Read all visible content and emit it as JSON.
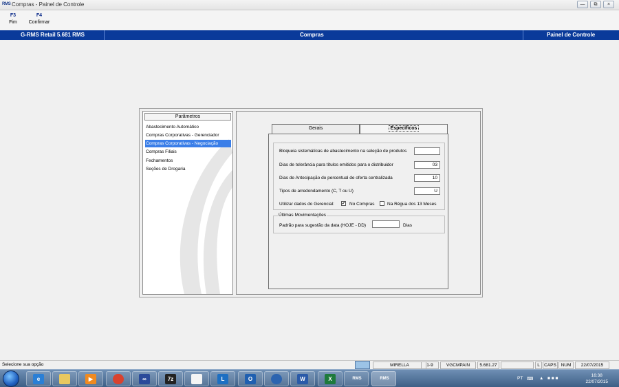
{
  "window": {
    "logo_text": "RMS",
    "title": "Compras - Painel de Controle",
    "controls": [
      "minimize",
      "restore",
      "close"
    ]
  },
  "function_keys": [
    {
      "key": "F3",
      "label": "Fim"
    },
    {
      "key": "F4",
      "label": "Confirmar"
    }
  ],
  "header_bar": {
    "left": "G-RMS Retail 5.681 RMS",
    "center": "Compras",
    "right": "Painel de Controle",
    "color": "#0a3a9a"
  },
  "parametros": {
    "header": "Parâmetros",
    "items": [
      "Abastecimento Automático",
      "Compras Corporativas - Gerenciador",
      "Compras Corporativas - Negociação",
      "Compras Filiais",
      "Fechamentos",
      "Seções de Drogaria"
    ],
    "selected_index": 2,
    "selected_color": "#3a7ee8"
  },
  "tabs": [
    "Gerais",
    "Específicos"
  ],
  "active_tab": "Específicos",
  "form": {
    "rows": [
      {
        "label": "Bloqueia sistemáticas de abastecimento na seleção de produtos",
        "value": ""
      },
      {
        "label": "Dias de tolerância para títulos emitidos para o distribuidor",
        "value": "03"
      },
      {
        "label": "Dias de Antecipação do percentual de oferta centralizada",
        "value": "10"
      },
      {
        "label": "Tipos de arredondamento (C, T ou U)",
        "value": "U"
      }
    ],
    "gerencial_label": "Utilizar dados do Gerencial:",
    "check_compras": {
      "label": "No Compras",
      "checked": true
    },
    "check_regua": {
      "label": "Na Régua dos 13 Meses",
      "checked": false
    },
    "ultimas": {
      "legend": "Últimas Movimentações",
      "label": "Padrão para sugestão da data (HOJE - DD)",
      "value": "",
      "suffix": "Dias"
    }
  },
  "status_bar": {
    "message": "Selecione sua opção",
    "cells": [
      "MIRELLA",
      "1-9",
      "VGCMPAIN",
      "5.681.27",
      "",
      "L",
      "CAPS",
      "NUM",
      "22/07/2015"
    ]
  },
  "taskbar": {
    "apps": [
      "internet-explorer",
      "file-explorer",
      "media-player",
      "chrome",
      "connector",
      "7zip",
      "document",
      "lync",
      "outlook",
      "network",
      "word",
      "excel",
      "rms-1",
      "rms-2"
    ],
    "app_texts": [
      "e",
      "",
      "▶",
      "",
      "∞",
      "7z",
      "",
      "L",
      "O",
      "",
      "W",
      "X",
      "RMS",
      "RMS"
    ],
    "language": "PT",
    "time": "16:38",
    "date": "22/07/2015"
  }
}
